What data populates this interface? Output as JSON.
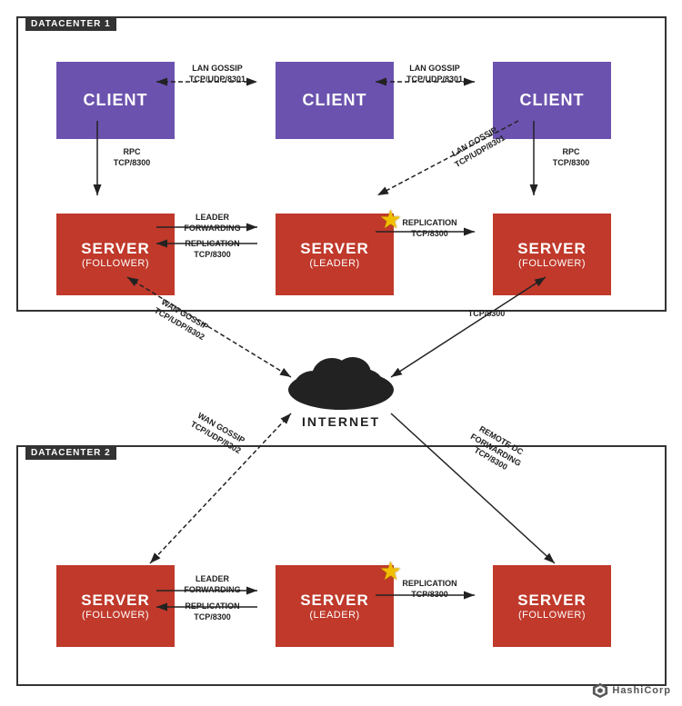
{
  "datacenter1": {
    "label": "DATACENTER 1"
  },
  "datacenter2": {
    "label": "DATACENTER 2"
  },
  "clients": [
    {
      "label": "CLIENT"
    },
    {
      "label": "CLIENT"
    },
    {
      "label": "CLIENT"
    }
  ],
  "servers_dc1": [
    {
      "label": "SERVER",
      "sub": "(FOLLOWER)"
    },
    {
      "label": "SERVER",
      "sub": "(LEADER)"
    },
    {
      "label": "SERVER",
      "sub": "(FOLLOWER)"
    }
  ],
  "servers_dc2": [
    {
      "label": "SERVER",
      "sub": "(FOLLOWER)"
    },
    {
      "label": "SERVER",
      "sub": "(LEADER)"
    },
    {
      "label": "SERVER",
      "sub": "(FOLLOWER)"
    }
  ],
  "arrows": {
    "lan_gossip": "LAN GOSSIP\nTCP/UDP/8301",
    "lan_gossip2": "LAN GOSSIP\nTCP/UDP/8301",
    "lan_gossip3": "LAN GOSSIP\nTCP/UDP/8301",
    "rpc1": "RPC\nTCP/8300",
    "rpc2": "RPC\nTCP/8300",
    "leader_fwd1": "LEADER\nFORWARDING",
    "replication1": "REPLICATION\nTCP/8300",
    "replication2": "REPLICATION\nTCP/8300",
    "wan_gossip": "WAN GOSSIP\nTCP/UDP/8302",
    "tcp8300_1": "TCP/8300",
    "remote_dc": "REMOTE DC\nFORWARDING\nTCP/8300",
    "wan_gossip2": "WAN GOSSIP\nTCP/UDP/8302",
    "leader_fwd2": "LEADER\nFORWARDING",
    "replication3": "REPLICATION\nTCP/8300"
  },
  "internet_label": "INTERNET",
  "hashicorp": "HashiCorp"
}
